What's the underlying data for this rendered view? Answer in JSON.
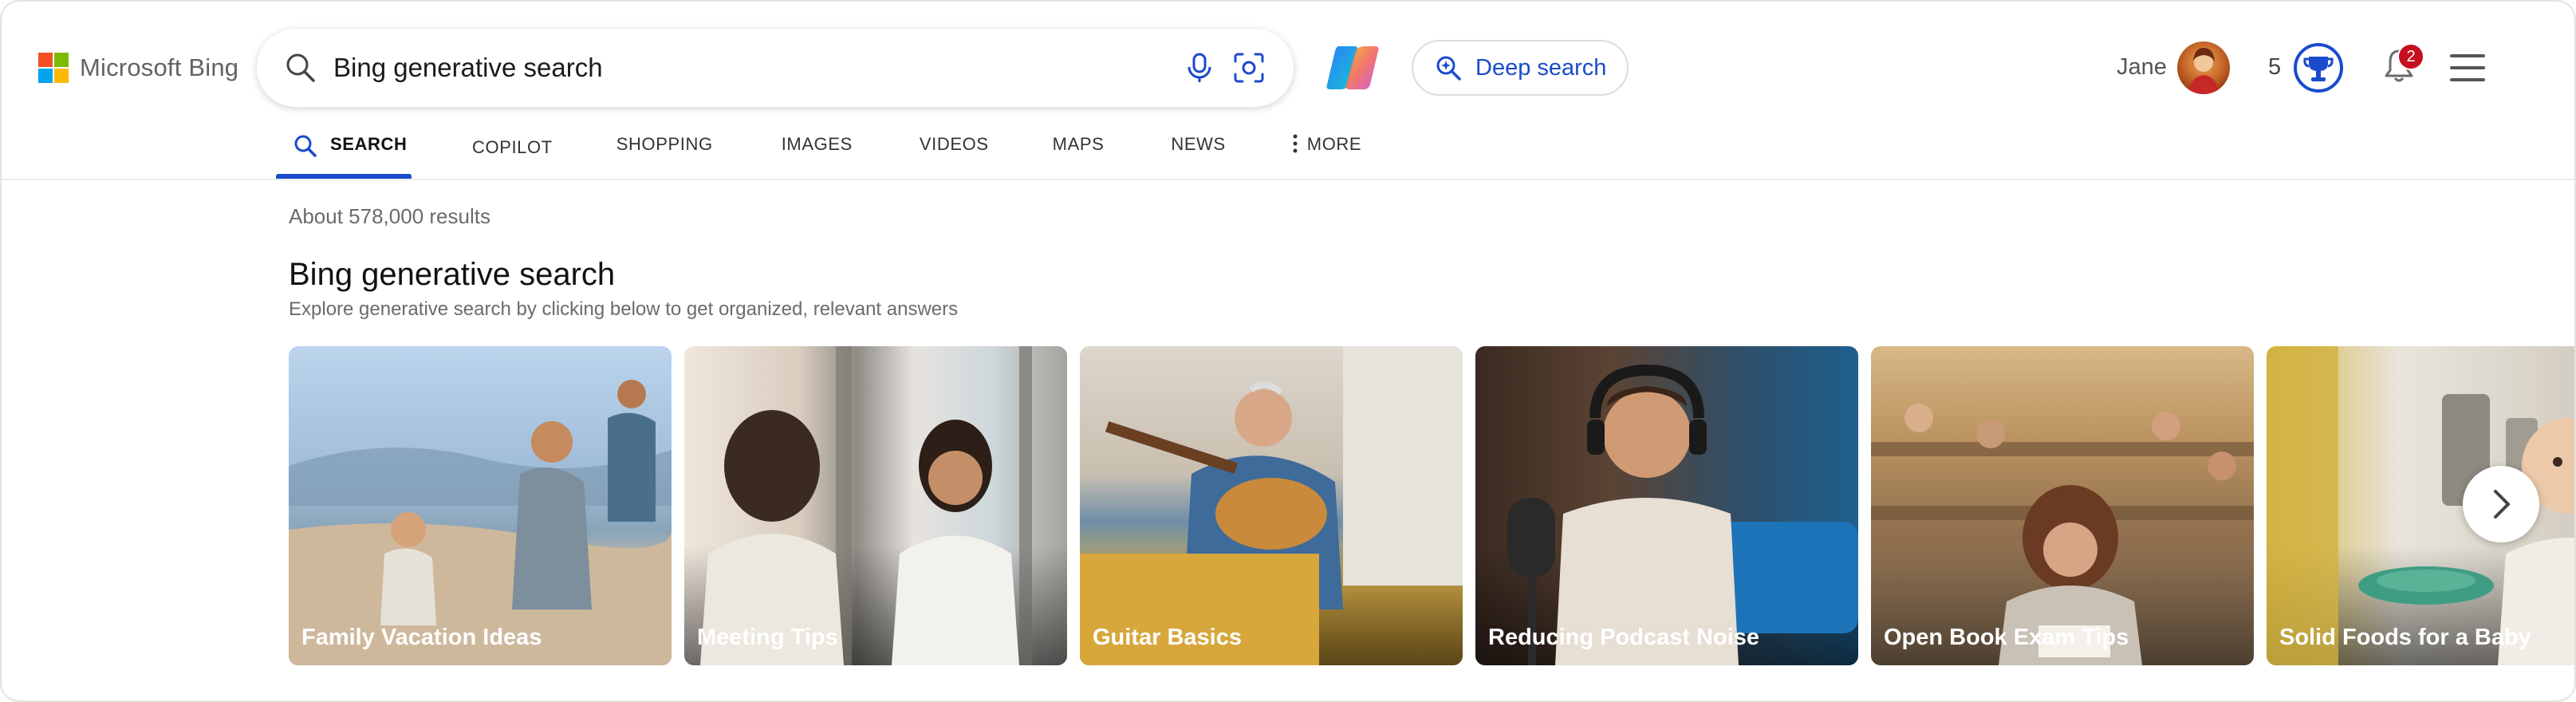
{
  "header": {
    "logo_text": "Microsoft Bing",
    "search": {
      "value": "Bing generative search"
    },
    "deep_search_label": "Deep search",
    "user_name": "Jane",
    "rewards_count": "5",
    "notifications_count": "2"
  },
  "tabs": [
    {
      "label": "SEARCH",
      "active": true
    },
    {
      "label": "COPILOT"
    },
    {
      "label": "SHOPPING"
    },
    {
      "label": "IMAGES"
    },
    {
      "label": "VIDEOS"
    },
    {
      "label": "MAPS"
    },
    {
      "label": "NEWS"
    },
    {
      "label": "MORE"
    }
  ],
  "results": {
    "count_text": "About 578,000 results",
    "section_title": "Bing generative search",
    "section_subtitle": "Explore generative search by clicking below to get organized, relevant answers"
  },
  "cards": [
    {
      "label": "Family Vacation Ideas"
    },
    {
      "label": "Meeting Tips"
    },
    {
      "label": "Guitar Basics"
    },
    {
      "label": "Reducing Podcast Noise"
    },
    {
      "label": "Open Book Exam Tips"
    },
    {
      "label": "Solid Foods for a Baby"
    }
  ],
  "colors": {
    "accent": "#1a4bcc",
    "badge": "#c50f1f"
  },
  "icons": [
    "search-icon",
    "microphone-icon",
    "visual-search-icon",
    "copilot-icon",
    "deep-search-icon",
    "rewards-icon",
    "bell-icon",
    "hamburger-menu-icon",
    "more-dots-icon",
    "chevron-right-icon"
  ]
}
